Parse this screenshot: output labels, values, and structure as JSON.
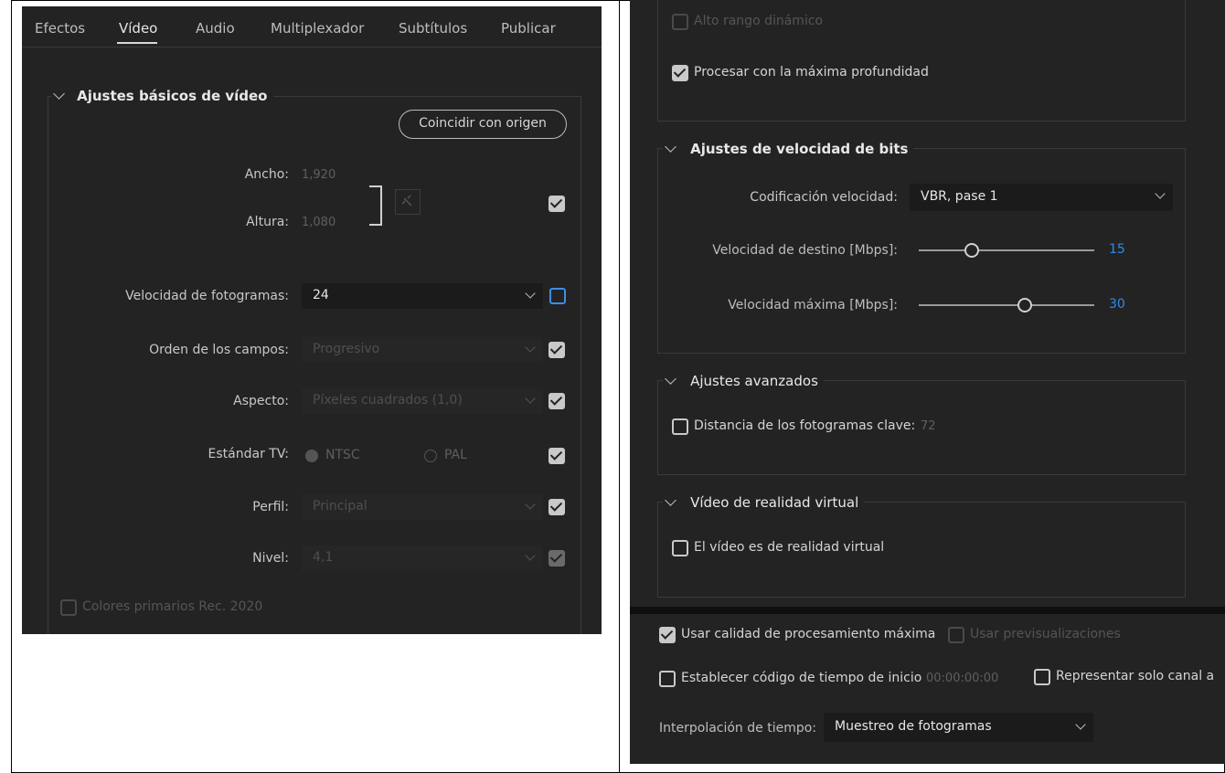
{
  "left": {
    "tabs": [
      {
        "label": "Efectos",
        "active": false
      },
      {
        "label": "Vídeo",
        "active": true
      },
      {
        "label": "Audio",
        "active": false
      },
      {
        "label": "Multiplexador",
        "active": false
      },
      {
        "label": "Subtítulos",
        "active": false
      },
      {
        "label": "Publicar",
        "active": false
      }
    ],
    "basic_section_title": "Ajustes básicos de vídeo",
    "match_source_label": "Coincidir con origen",
    "width_label": "Ancho:",
    "width_value": "1,920",
    "height_label": "Altura:",
    "height_value": "1,080",
    "frame_rate_label": "Velocidad de fotogramas:",
    "frame_rate_value": "24",
    "field_order_label": "Orden de los campos:",
    "field_order_value": "Progresivo",
    "aspect_label": "Aspecto:",
    "aspect_value": "Píxeles cuadrados (1,0)",
    "tv_standard_label": "Estándar TV:",
    "tv_ntsc": "NTSC",
    "tv_pal": "PAL",
    "profile_label": "Perfil:",
    "profile_value": "Principal",
    "level_label": "Nivel:",
    "level_value": "4,1",
    "rec2020_label": "Colores primarios Rec. 2020"
  },
  "right": {
    "hdr_label": "Alto rango dinámico",
    "max_depth_label": "Procesar con la máxima profundidad",
    "bitrate_section_title": "Ajustes de velocidad de bits",
    "bitrate_encoding_label": "Codificación velocidad:",
    "bitrate_encoding_value": "VBR, pase 1",
    "target_bitrate_label": "Velocidad de destino [Mbps]:",
    "target_bitrate_value": "15",
    "target_bitrate_fraction": 0.28,
    "max_bitrate_label": "Velocidad máxima [Mbps]:",
    "max_bitrate_value": "30",
    "max_bitrate_fraction": 0.6,
    "advanced_section_title": "Ajustes avanzados",
    "keyframe_label": "Distancia de los fotogramas clave:",
    "keyframe_value": "72",
    "vr_section_title": "Vídeo de realidad virtual",
    "vr_label": "El vídeo es de realidad virtual",
    "max_quality_label": "Usar calidad de procesamiento máxima",
    "use_previews_label": "Usar previsualizaciones",
    "start_timecode_label": "Establecer código de tiempo de inicio",
    "start_timecode_value": "00:00:00:00",
    "alpha_only_label": "Representar solo canal a",
    "time_interp_label": "Interpolación de tiempo:",
    "time_interp_value": "Muestreo de fotogramas"
  },
  "colors": {
    "panel_bg": "#232323",
    "accent_blue": "#2d8ceb"
  }
}
